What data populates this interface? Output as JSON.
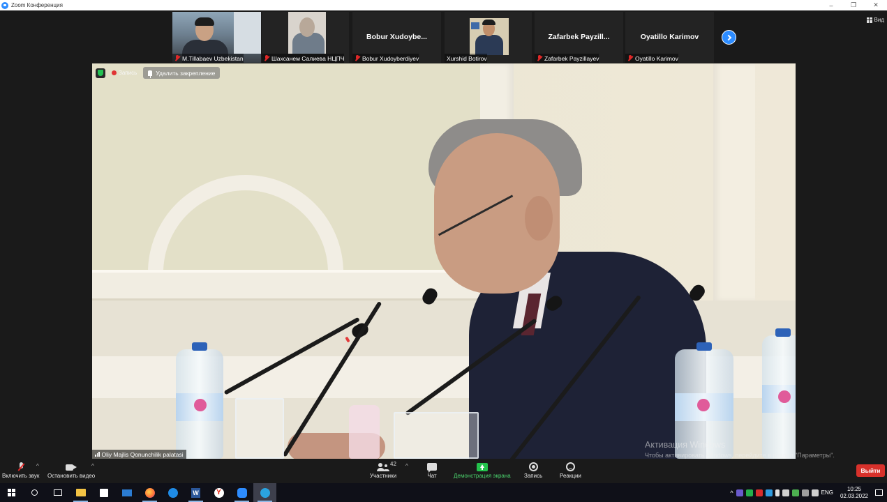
{
  "window": {
    "title": "Zoom Конференция",
    "minimize": "–",
    "maximize": "❐",
    "close": "✕"
  },
  "view_button": "Вид",
  "participants": [
    {
      "name": "M.Tillabaev Uzbekistan",
      "muted": true,
      "has_video": true
    },
    {
      "name": "Шахсанем Салиева НЦПЧ",
      "muted": true,
      "has_video": true
    },
    {
      "name": "Bobur Xudoyberdiyev",
      "display": "Bobur  Xudoybe...",
      "muted": true,
      "has_video": false
    },
    {
      "name": "Xurshid Botirov",
      "muted": false,
      "has_video": true
    },
    {
      "name": "Zafarbek Payzillayev",
      "display": "Zafarbek  Payzill...",
      "muted": true,
      "has_video": false
    },
    {
      "name": "Oyatillo Karimov",
      "display": "Oyatillo Karimov",
      "muted": true,
      "has_video": false
    }
  ],
  "main_video": {
    "recording_label": "Запись",
    "unpin_label": "Удалить закрепление",
    "speaker_name": "Oliy Majlis Qonunchilik palatasi"
  },
  "activation_watermark": {
    "line1": "Активация Windows",
    "line2": "Чтобы активировать Windows, перейдите в раздел \"Параметры\"."
  },
  "toolbar": {
    "unmute": "Включить звук",
    "stop_video": "Остановить видео",
    "participants": "Участники",
    "participants_count": "42",
    "chat": "Чат",
    "share": "Демонстрация экрана",
    "record": "Запись",
    "reactions": "Реакции",
    "leave": "Выйти"
  },
  "taskbar": {
    "time": "10:25",
    "date": "02.03.2022",
    "language": "ENG",
    "apps": [
      "file-explorer",
      "store",
      "mail",
      "firefox",
      "edge",
      "word",
      "yandex",
      "zoom",
      "telegram"
    ]
  },
  "colors": {
    "share_green": "#23c24c",
    "leave_red": "#d8312b",
    "muted_red": "#e02828",
    "next_blue": "#2d8cff"
  }
}
